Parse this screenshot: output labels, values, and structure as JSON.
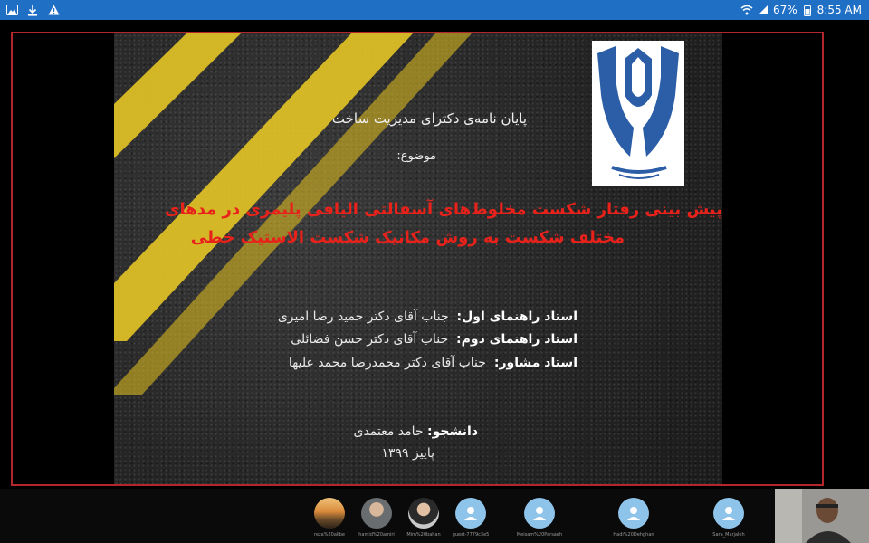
{
  "status_bar": {
    "battery": "67%",
    "time": "8:55 AM"
  },
  "slide": {
    "thesis_label": "پایان نامه‌ی دکترای مدیریت ساخت",
    "subject_label": "موضوع:",
    "title_line1": "پیش بینی رفتار شکست مخلوط‌های آسفالتی الیافی پلیمری در مدهای",
    "title_line2": "مختلف شکست به روش مکانیک شکست الاستیک خطی",
    "advisors": [
      {
        "role": "استاد راهنمای اول:",
        "name": "جناب آقای دکتر حمید رضا امیری"
      },
      {
        "role": "استاد راهنمای دوم:",
        "name": "جناب آقای دکتر حسن فضائلی"
      },
      {
        "role": "استاد مشاور:",
        "name": "جناب آقای دکتر محمدرضا محمد علیها"
      }
    ],
    "student_role": "دانشجو:",
    "student_name": "حامد معتمدی",
    "semester": "پاییز ۱۳۹۹"
  },
  "participants": [
    {
      "name": "reza%20alibe"
    },
    {
      "name": "hamid%20amiri"
    },
    {
      "name": "Mim%20bahan"
    },
    {
      "name": "guest-7779c3e5"
    },
    {
      "name": "Meisam%20Parsaeh"
    },
    {
      "name": "Hadi%20Dehghan"
    },
    {
      "name": "Sara_Marjaleh"
    }
  ],
  "colors": {
    "status_bar": "#1f6fc5",
    "frame": "#b3262c",
    "title_red": "#e8221b",
    "road_yellow": "#e2c225",
    "avatar_blue": "#8ec3ea",
    "emblem_blue": "#2b5ea7"
  }
}
